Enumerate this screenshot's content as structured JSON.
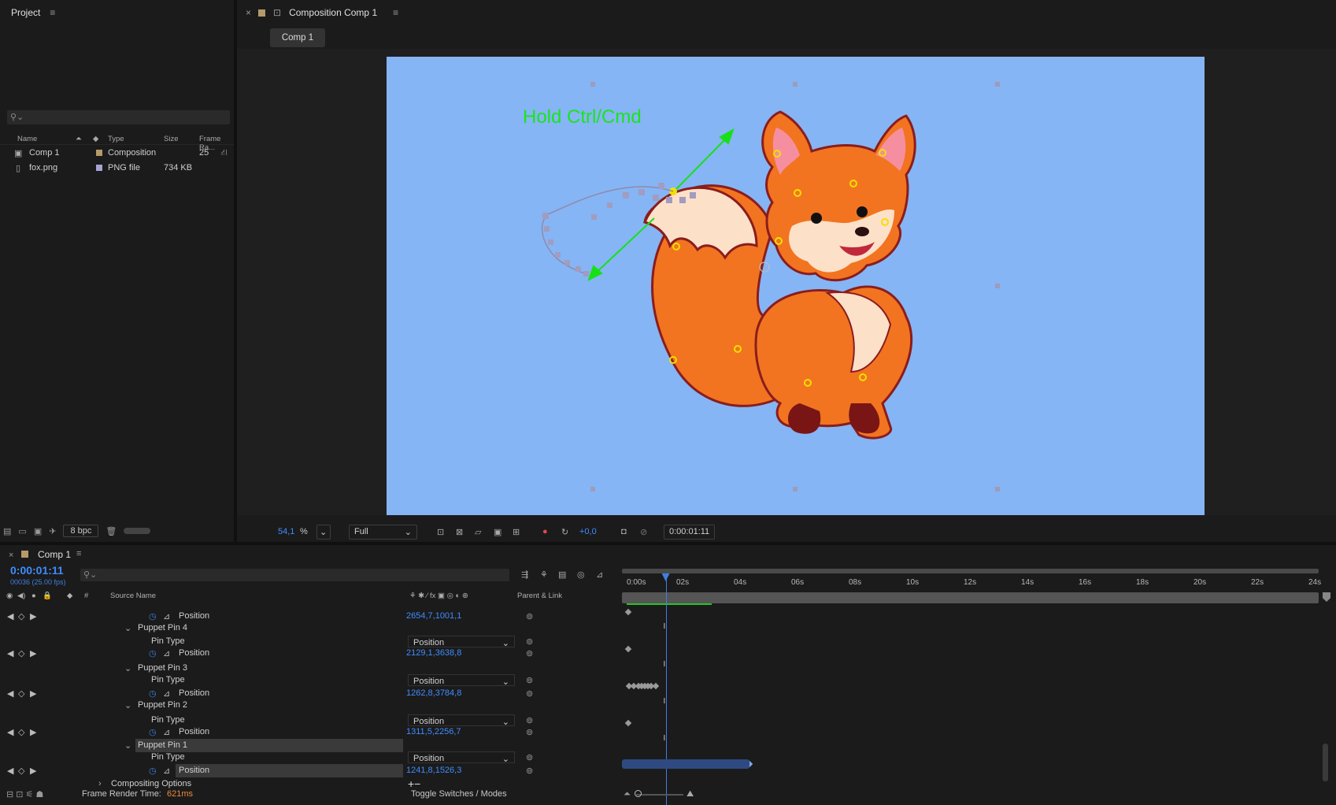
{
  "project": {
    "title": "Project",
    "search_placeholder": "",
    "columns": [
      "Name",
      "Type",
      "Size",
      "Frame Ra..."
    ],
    "items": [
      {
        "name": "Comp 1",
        "type": "Composition",
        "size": "",
        "frame_rate": "25",
        "label_color": "#b59a6a"
      },
      {
        "name": "fox.png",
        "type": "PNG file",
        "size": "734 KB",
        "frame_rate": "",
        "label_color": "#a6a3d4"
      }
    ],
    "bpc": "8 bpc"
  },
  "viewer": {
    "panel_title": "Composition Comp 1",
    "tab": "Comp 1",
    "overlay_hint": "Hold Ctrl/Cmd",
    "zoom": "54,1",
    "zoom_unit": "%",
    "resolution": "Full",
    "exposure": "+0,0",
    "timecode": "0:00:01:11",
    "background_color": "#85b5f5"
  },
  "timeline": {
    "tab": "Comp 1",
    "timecode": "0:00:01:11",
    "frame_info": "00036 (25.00 fps)",
    "search_placeholder": "",
    "col_source": "Source Name",
    "col_hash": "#",
    "col_parent": "Parent & Link",
    "ruler": [
      "0:00s",
      "02s",
      "04s",
      "06s",
      "08s",
      "10s",
      "12s",
      "14s",
      "16s",
      "18s",
      "20s",
      "22s",
      "24s"
    ],
    "rows": [
      {
        "kind": "prop",
        "label": "Position",
        "value": "2654,7,1001,1"
      },
      {
        "kind": "group",
        "label": "Puppet Pin 4"
      },
      {
        "kind": "type",
        "label": "Pin Type",
        "value": "Position"
      },
      {
        "kind": "prop",
        "label": "Position",
        "value": "2129,1,3638,8"
      },
      {
        "kind": "group",
        "label": "Puppet Pin 3"
      },
      {
        "kind": "type",
        "label": "Pin Type",
        "value": "Position"
      },
      {
        "kind": "prop",
        "label": "Position",
        "value": "1262,8,3784,8"
      },
      {
        "kind": "group",
        "label": "Puppet Pin 2"
      },
      {
        "kind": "type",
        "label": "Pin Type",
        "value": "Position"
      },
      {
        "kind": "prop",
        "label": "Position",
        "value": "1311,5,2256,7"
      },
      {
        "kind": "group",
        "label": "Puppet Pin 1"
      },
      {
        "kind": "type",
        "label": "Pin Type",
        "value": "Position"
      },
      {
        "kind": "prop",
        "label": "Position",
        "value": "1241,8,1526,3"
      }
    ],
    "compositing_options": "Compositing Options",
    "frame_render_label": "Frame Render Time:",
    "frame_render_value": "621ms",
    "toggle_label": "Toggle Switches / Modes",
    "playhead_seconds": 1.44,
    "duration_seconds": 24
  }
}
